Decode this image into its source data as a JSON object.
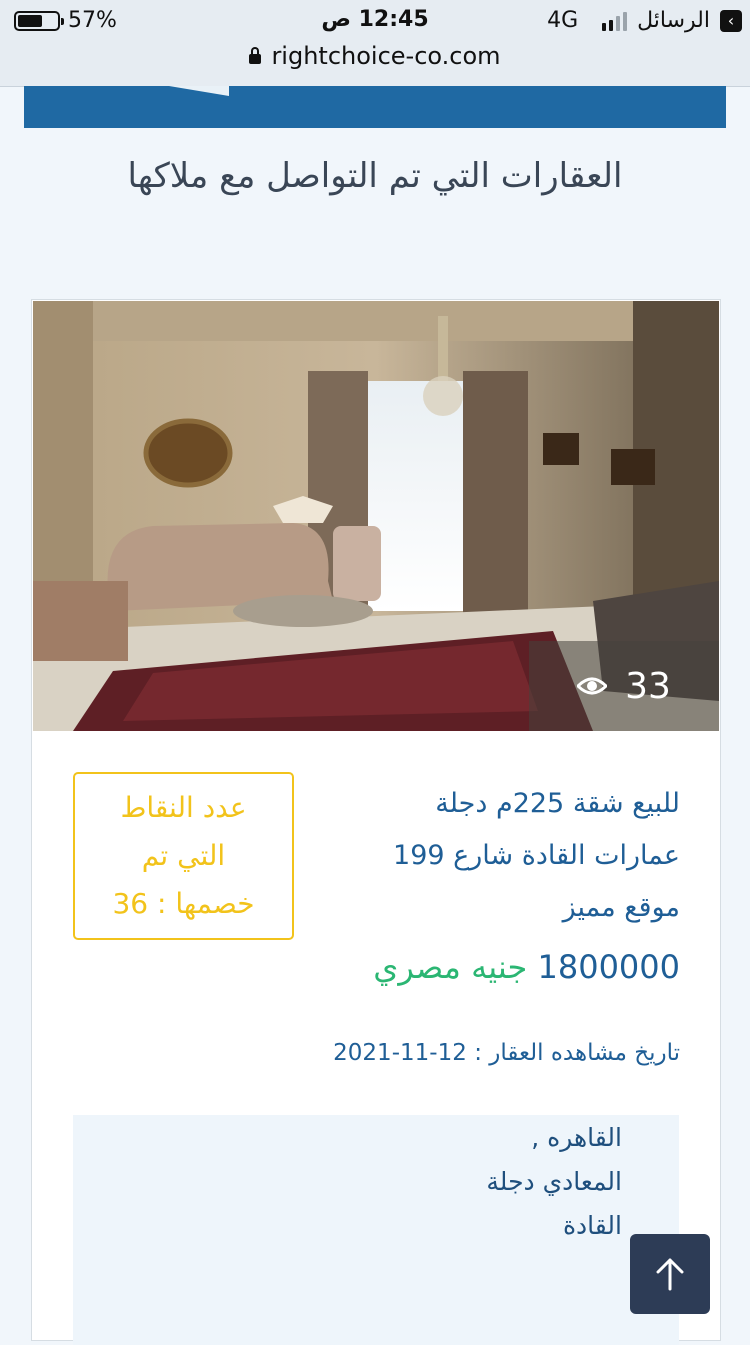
{
  "status_bar": {
    "battery_percent": "57%",
    "time": "12:45 ص",
    "network": "4G",
    "back_app": "الرسائل"
  },
  "browser": {
    "url": "rightchoice-co.com"
  },
  "page": {
    "heading": "العقارات التي تم التواصل مع ملاكها"
  },
  "listing": {
    "view_count": "33",
    "title_lines": [
      "للبيع شقة 225م دجلة",
      "عمارات القادة شارع 199",
      "موقع مميز"
    ],
    "price_amount": "1800000",
    "price_currency": "جنيه مصري",
    "points_lines": [
      "عدد النقاط",
      "التي تم",
      "خصمها : 36"
    ],
    "view_date": "تاريخ مشاهده العقار : 12-11-2021",
    "address_lines": [
      "القاهره ,",
      "المعادي دجلة",
      "القادة"
    ]
  },
  "colors": {
    "accent_blue": "#1f69a3",
    "text_blue": "#1f5e96",
    "points_yellow": "#f2c31b",
    "currency_green": "#2bb673",
    "scroll_button": "#2d3c56"
  },
  "icons": [
    "battery-icon",
    "signal-icon",
    "back-arrow-icon",
    "lock-icon",
    "eye-icon",
    "arrow-up-icon"
  ]
}
